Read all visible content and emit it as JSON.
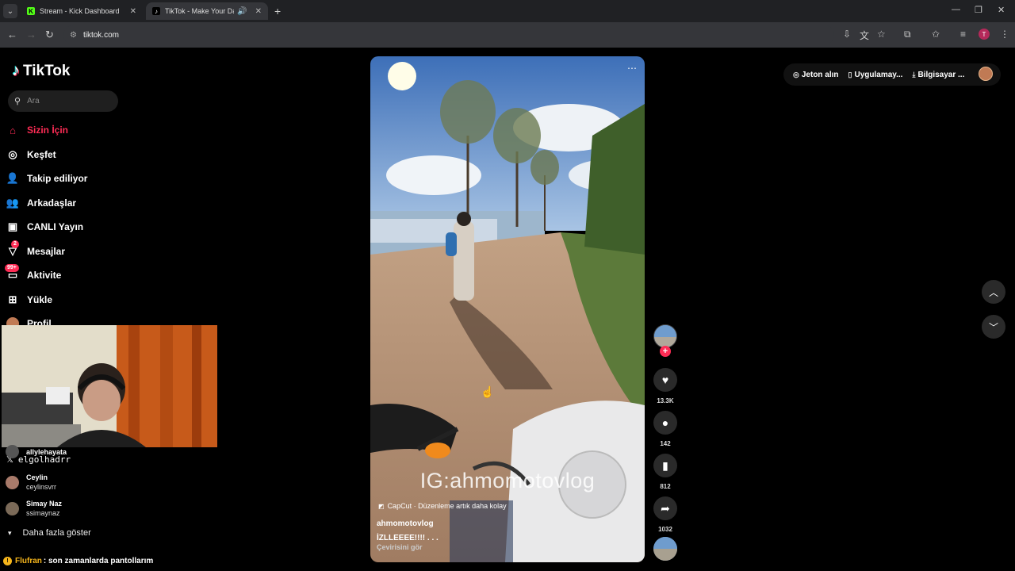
{
  "browser": {
    "tabs": [
      {
        "title": "Stream - Kick Dashboard",
        "favicon": "kick-icon"
      },
      {
        "title": "TikTok - Make Your Day",
        "favicon": "tiktok-icon"
      }
    ],
    "url": "tiktok.com"
  },
  "sidebar": {
    "logo_text": "TikTok",
    "search_placeholder": "Ara",
    "items": [
      {
        "label": "Sizin İçin",
        "icon": "home-icon",
        "active": true
      },
      {
        "label": "Keşfet",
        "icon": "compass-icon"
      },
      {
        "label": "Takip ediliyor",
        "icon": "person-follow-icon"
      },
      {
        "label": "Arkadaşlar",
        "icon": "friends-icon"
      },
      {
        "label": "CANLI Yayın",
        "icon": "live-tv-icon"
      },
      {
        "label": "Mesajlar",
        "icon": "message-icon",
        "badge": "2"
      },
      {
        "label": "Aktivite",
        "icon": "activity-icon",
        "badge": "99+"
      },
      {
        "label": "Yükle",
        "icon": "upload-icon"
      },
      {
        "label": "Profil",
        "icon": "profile-avatar"
      }
    ],
    "following": [
      {
        "name": "allylehayata",
        "handle": "allylehayata"
      },
      {
        "name": "Ceylin",
        "handle": "ceylinsvrr"
      },
      {
        "name": "Simay Naz",
        "handle": "ssimaynaz"
      }
    ],
    "show_more": "Daha fazla göster"
  },
  "stream_overlay": {
    "username": "elgolhadrr",
    "chat": {
      "user": "Flufran",
      "message": ": son zamanlarda pantollarım"
    }
  },
  "video": {
    "watermark": "IG:ahmomotovlog",
    "capcut_text": "CapCut · Düzenleme artık daha kolay",
    "author": "ahmomotovlog",
    "caption": "İZLLEEEE!!!! . . .",
    "translate": "Çevirisini gör"
  },
  "actions": {
    "likes": "13.3K",
    "comments": "142",
    "saves": "812",
    "shares": "1032"
  },
  "top_bar": {
    "coins": "Jeton alın",
    "app": "Uygulamay...",
    "desktop": "Bilgisayar ..."
  },
  "colors": {
    "accent": "#fe2c55",
    "background": "#000000"
  }
}
